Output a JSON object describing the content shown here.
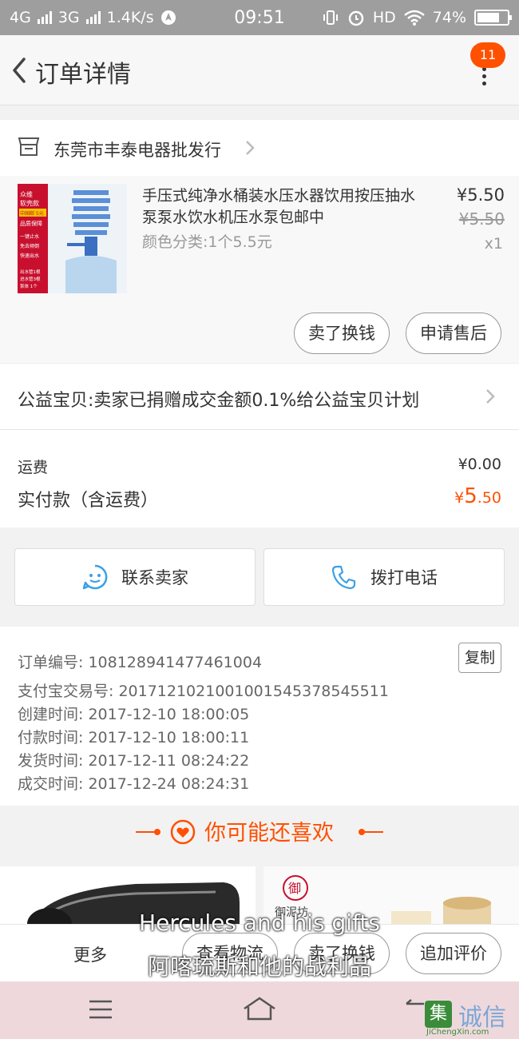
{
  "status_bar": {
    "network1": "4G",
    "network2": "3G",
    "speed": "1.4K/s",
    "time": "09:51",
    "hd": "HD",
    "battery": "74%",
    "battery_level": 0.74
  },
  "header": {
    "title": "订单详情",
    "badge_count": "11"
  },
  "shop": {
    "name": "东莞市丰泰电器批发行"
  },
  "product": {
    "title": "手压式纯净水桶装水压水器饮用按压抽水泵泵水饮水机压水泵包邮中",
    "sku": "颜色分类:1个5.5元",
    "price": "¥5.50",
    "original_price": "¥5.50",
    "quantity": "x1",
    "image_texts": [
      "众维",
      "软壳款",
      "中国邮 5元",
      "品质保障",
      "一键止水",
      "免去倾倒",
      "快速出水",
      "出水管1根",
      "进水管3根",
      "泵体 1个"
    ],
    "buttons": {
      "sell": "卖了换钱",
      "after_sale": "申请售后"
    }
  },
  "charity": {
    "text": "公益宝贝:卖家已捐赠成交金额0.1%给公益宝贝计划"
  },
  "fees": {
    "shipping_label": "运费",
    "shipping_value": "¥0.00",
    "paid_label": "实付款（含运费）",
    "paid_symbol": "¥",
    "paid_int": "5",
    "paid_dec": ".50"
  },
  "contact": {
    "seller": "联系卖家",
    "call": "拨打电话"
  },
  "order_info": {
    "order_no": "订单编号: 108128941477461004",
    "copy": "复制",
    "alipay_no": "支付宝交易号: 2017121021001001545378545511",
    "created": "创建时间: 2017-12-10 18:00:05",
    "paid": "付款时间: 2017-12-10 18:00:11",
    "shipped": "发货时间: 2017-12-11 08:24:22",
    "completed": "成交时间: 2017-12-24 08:24:31"
  },
  "recommend": {
    "title": "你可能还喜欢",
    "card2_logo": "御",
    "card2_text": "御泥坊"
  },
  "action_bar": {
    "more": "更多",
    "logistics": "查看物流",
    "sell": "卖了换钱",
    "review": "追加评价"
  },
  "subtitles": {
    "line1": "Hercules and his gifts",
    "line2": "阿喀琉斯和他的战利品"
  },
  "watermark": {
    "text": "诚信",
    "logo_char": "集",
    "site": "JiChengXin.com"
  },
  "colors": {
    "accent": "#ff5000",
    "status_bar": "#9e9e9e",
    "nav_bar": "#efd8dc",
    "contact_icon": "#3aa0e6"
  }
}
